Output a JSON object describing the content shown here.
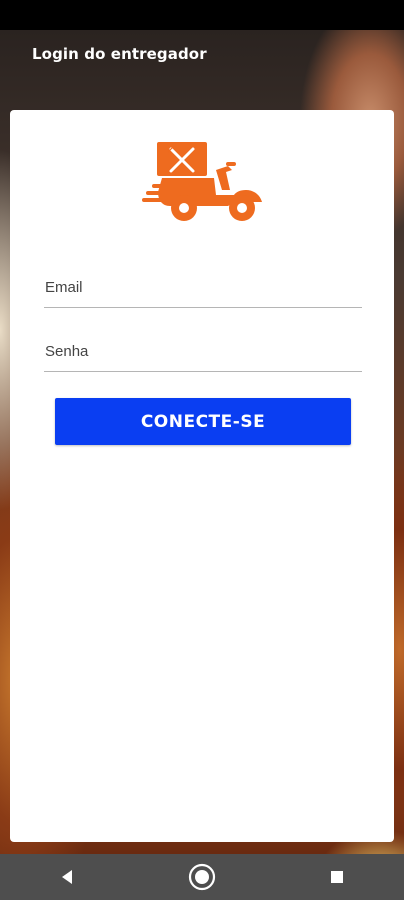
{
  "header": {
    "title": "Login do entregador"
  },
  "logo": {
    "icon": "delivery-scooter-icon",
    "color": "#ee6b1f"
  },
  "form": {
    "email": {
      "value": "",
      "placeholder": "Email"
    },
    "password": {
      "value": "",
      "placeholder": "Senha"
    },
    "submit_label": "CONECTE-SE",
    "submit_color": "#0a3ef2"
  },
  "nav_bar": {
    "buttons": [
      {
        "icon": "back-triangle-icon"
      },
      {
        "icon": "home-circle-icon"
      },
      {
        "icon": "recents-square-icon"
      }
    ]
  }
}
